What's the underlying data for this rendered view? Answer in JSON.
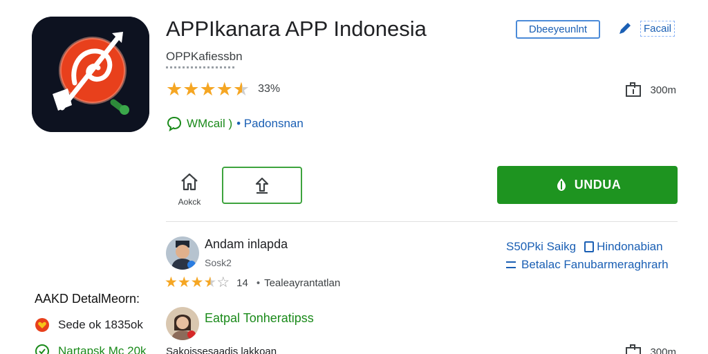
{
  "app": {
    "title": "APPIkanara APP Indonesia",
    "developer": "OPPKafiessbn",
    "rating_count": "33%",
    "size": "300m",
    "badge_green": "WMcail )",
    "badge_blue": "• Padonsnan",
    "icon": "app-logo-icon"
  },
  "top_actions": {
    "developer_button": "Dbeeyeunlnt",
    "edit_label": "Facail"
  },
  "actions": {
    "home_label": "Aokck",
    "install_label": "UNDUA"
  },
  "reviews": [
    {
      "name": "Andam inlapda",
      "sub": "Sosk2",
      "count": "14",
      "tag": "Tealeayrantatlan"
    },
    {
      "name": "Eatpal Tonheratipss",
      "text": "Sakoissesaadis lakkoan",
      "size": "300m"
    }
  ],
  "right_info": {
    "line1_left": "S50Pki Saikg",
    "line1_right": "Hindonabian",
    "line2": "Betalac Fanubarmeraghrarh"
  },
  "side": {
    "title": "AAKD DetalMeorn:",
    "item1": "Sede ok  1835ok",
    "item2": "Nartapsk Mc 20k"
  },
  "colors": {
    "install_green": "#1e9420",
    "star": "#f5a623",
    "link_blue": "#1a5fb4",
    "badge_green": "#1a8a1a"
  }
}
